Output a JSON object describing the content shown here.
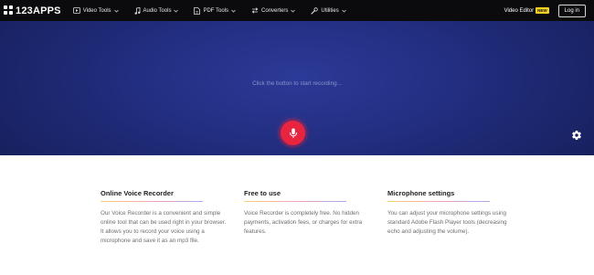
{
  "header": {
    "logo_text": "123APPS",
    "nav": [
      {
        "label": "Video Tools",
        "icon": "video-play-icon"
      },
      {
        "label": "Audio Tools",
        "icon": "music-note-icon"
      },
      {
        "label": "PDF Tools",
        "icon": "pdf-file-icon"
      },
      {
        "label": "Converters",
        "icon": "converter-arrows-icon"
      },
      {
        "label": "Utilities",
        "icon": "wrench-icon"
      }
    ],
    "video_editor": "Video Editor",
    "new_badge": "NEW",
    "login": "Log in"
  },
  "recorder": {
    "hint": "Click the button to start recording...",
    "record_icon": "microphone-icon",
    "settings_icon": "gear-icon",
    "colors": {
      "hero_center": "#2c3a98",
      "hero_edge": "#17205d",
      "record_button": "#e8243e"
    }
  },
  "info": [
    {
      "title": "Online Voice Recorder",
      "text": "Our Voice Recorder is a convenient and simple online tool that can be used right in your browser. It allows you to record your voice using a microphone and save it as an mp3 file."
    },
    {
      "title": "Free to use",
      "text": "Voice Recorder is completely free. No hidden payments, activation fees, or charges for extra features."
    },
    {
      "title": "Microphone settings",
      "text": "You can adjust your microphone settings using standard Adobe Flash Player tools (decreasing echo and adjusting the volume)."
    }
  ]
}
